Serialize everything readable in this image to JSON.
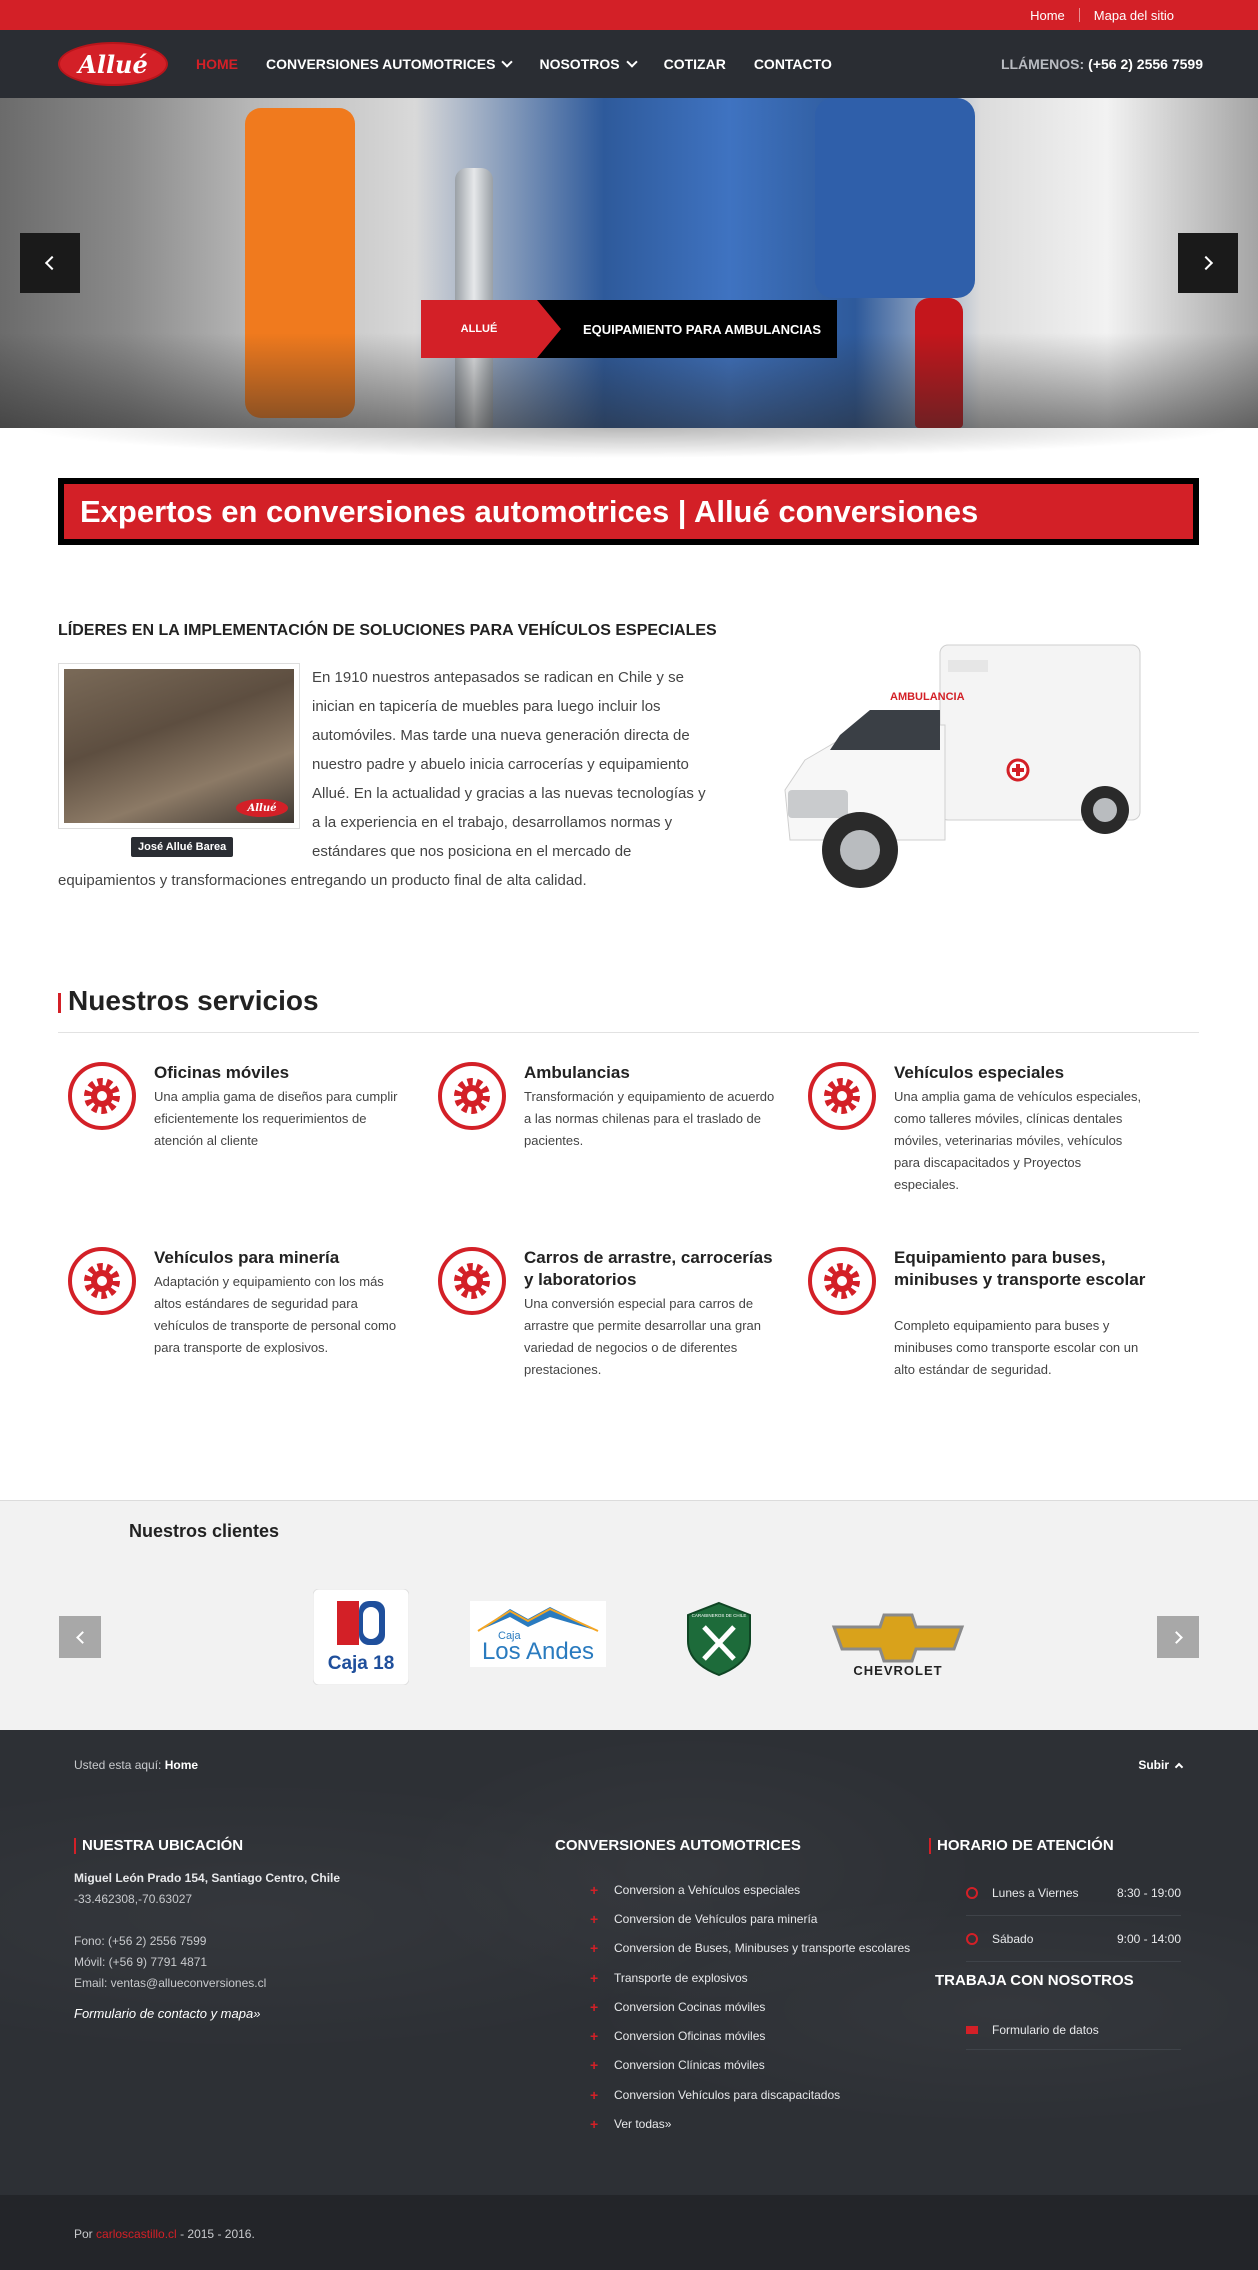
{
  "topbar": {
    "links": [
      "Home",
      "Mapa del sitio"
    ]
  },
  "header": {
    "logo_text": "Allué",
    "nav": [
      {
        "label": "HOME",
        "active": true,
        "dropdown": false
      },
      {
        "label": "CONVERSIONES AUTOMOTRICES",
        "active": false,
        "dropdown": true
      },
      {
        "label": "NOSOTROS",
        "active": false,
        "dropdown": true
      },
      {
        "label": "COTIZAR",
        "active": false,
        "dropdown": false
      },
      {
        "label": "CONTACTO",
        "active": false,
        "dropdown": false
      }
    ],
    "call_label": "LLÁMENOS:",
    "call_number": "(+56 2) 2556 7599"
  },
  "hero": {
    "caption_brand": "ALLUÉ",
    "caption_title": "EQUIPAMIENTO PARA AMBULANCIAS",
    "prev_icon": "chevron-left-icon",
    "next_icon": "chevron-right-icon"
  },
  "banner": {
    "text": "Expertos en conversiones automotrices | Allué conversiones"
  },
  "intro": {
    "title": "LÍDERES EN LA IMPLEMENTACIÓN DE SOLUCIONES PARA VEHÍCULOS ESPECIALES",
    "portrait_caption": "José Allué Barea",
    "portrait_stamp": "Allué",
    "text": "En 1910 nuestros antepasados se radican en Chile y se inician en tapicería de muebles para luego incluir los automóviles. Mas tarde una nueva generación directa de nuestro padre y abuelo inicia carrocerías y equipamiento Allué. En la actualidad y gracias a las nuevas tecnologías y a la experiencia en el trabajo, desarrollamos normas y estándares que nos posiciona en el mercado de equipamientos y transformaciones entregando un producto final de alta calidad.",
    "vehicle_label": "AMBULANCIA"
  },
  "services": {
    "title": "Nuestros servicios",
    "items": [
      {
        "title": "Oficinas móviles",
        "desc": "Una amplia gama de diseños para cumplir eficientemente los requerimientos de atención al cliente"
      },
      {
        "title": "Ambulancias",
        "desc": "Transformación y equipamiento de acuerdo a las normas chilenas para el traslado de pacientes."
      },
      {
        "title": "Vehículos especiales",
        "desc": "Una amplia gama de vehículos especiales, como talleres móviles, clínicas dentales móviles, veterinarias móviles, vehículos para discapacitados y Proyectos especiales."
      },
      {
        "title": "Vehículos para minería",
        "desc": "Adaptación y equipamiento con los más altos estándares de seguridad para vehículos de transporte de personal como para transporte de explosivos."
      },
      {
        "title": "Carros de arrastre, carrocerías y laboratorios",
        "desc": "Una conversión especial para carros de arrastre que permite desarrollar una gran variedad de negocios o de diferentes prestaciones."
      },
      {
        "title": "Equipamiento para buses, minibuses y transporte escolar",
        "desc": "Completo equipamiento para buses y minibuses como transporte escolar con un alto estándar de seguridad."
      }
    ],
    "icon": "gear-icon"
  },
  "clients": {
    "title": "Nuestros clientes",
    "logos": [
      {
        "name": "Caja 18",
        "text": "Caja 18"
      },
      {
        "name": "Caja Los Andes",
        "small": "Caja",
        "text": "Los Andes"
      },
      {
        "name": "Carabineros de Chile",
        "text": "CARABINEROS DE CHILE"
      },
      {
        "name": "Chevrolet",
        "text": "CHEVROLET"
      }
    ]
  },
  "footer": {
    "breadcrumb_label": "Usted esta aquí:",
    "breadcrumb_current": "Home",
    "subir": "Subir",
    "ubicacion": {
      "title": "NUESTRA UBICACIÓN",
      "address": "Miguel León Prado 154, Santiago Centro, Chile",
      "coords": "-33.462308,-70.63027",
      "fono": "Fono: (+56 2) 2556 7599",
      "movil": "Móvil: (+56 9) 7791 4871",
      "email": "Email: ventas@allueconversiones.cl",
      "form_link": "Formulario de contacto y mapa»"
    },
    "conversiones": {
      "title": "CONVERSIONES AUTOMOTRICES",
      "items": [
        "Conversion a Vehículos especiales",
        "Conversion de Vehículos para minería",
        "Conversion de Buses, Minibuses y transporte escolares",
        "Transporte de explosivos",
        "Conversion Cocinas móviles",
        "Conversion Oficinas móviles",
        "Conversion Clínicas móviles",
        "Conversion Vehículos para discapacitados",
        "Ver todas»"
      ]
    },
    "horario": {
      "title": "HORARIO DE ATENCIÓN",
      "rows": [
        {
          "day": "Lunes a Viernes",
          "time": "8:30 - 19:00"
        },
        {
          "day": "Sábado",
          "time": "9:00 - 14:00"
        }
      ]
    },
    "trabaja": {
      "title": "TRABAJA CON NOSOTROS",
      "link": "Formulario de datos"
    }
  },
  "copyright": {
    "prefix": "Por",
    "author": "carloscastillo.cl",
    "suffix": "- 2015 - 2016."
  },
  "colors": {
    "accent": "#d32027",
    "dark": "#2a2d33"
  }
}
